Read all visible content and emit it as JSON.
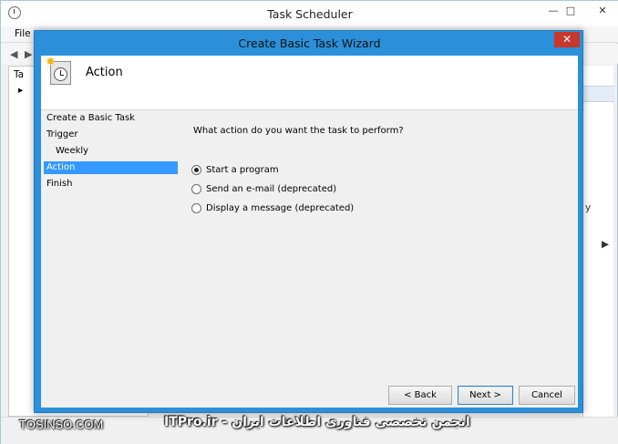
{
  "background_window": {
    "title": "Task Scheduler",
    "menu_file": "File",
    "controls": [
      "—",
      "□",
      "✕"
    ],
    "tree_items": [
      "Ta",
      ""
    ],
    "right_fragments": [
      "y"
    ]
  },
  "dialog": {
    "title": "Create Basic Task Wizard",
    "close": "✕",
    "header_title": "Action",
    "steps": [
      {
        "label": "Create a Basic Task",
        "sub": false,
        "active": false
      },
      {
        "label": "Trigger",
        "sub": false,
        "active": false
      },
      {
        "label": "Weekly",
        "sub": true,
        "active": false
      },
      {
        "label": "Action",
        "sub": false,
        "active": true
      },
      {
        "label": "Finish",
        "sub": false,
        "active": false
      }
    ],
    "question": "What action do you want the task to perform?",
    "options": [
      {
        "label": "Start a program",
        "checked": true
      },
      {
        "label": "Send an e-mail (deprecated)",
        "checked": false
      },
      {
        "label": "Display a message (deprecated)",
        "checked": false
      }
    ],
    "buttons": {
      "back": "< Back",
      "next": "Next >",
      "cancel": "Cancel"
    }
  },
  "watermark": {
    "left": "TOSINSO.COM",
    "right": "انجمن تخصصی فناوری اطلاعات ایران - ITPro.ir"
  },
  "icons": [
    "clock-icon",
    "wizard-task-icon",
    "close-icon",
    "minimize-icon",
    "maximize-icon",
    "back-arrow-icon",
    "forward-arrow-icon"
  ],
  "colors": {
    "dialog_frame": "#2b90d9",
    "selected_step": "#3399ff",
    "close_button": "#c9372c"
  }
}
